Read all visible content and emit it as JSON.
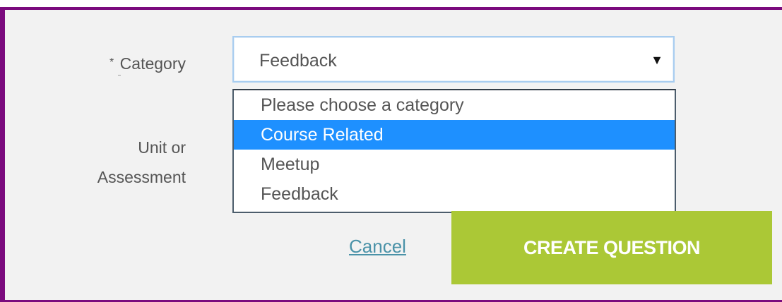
{
  "form": {
    "category_required_mark": "*",
    "category_label": "Category",
    "unit_label_line1": "Unit or",
    "unit_label_line2": "Assessment",
    "category_select": {
      "selected_value": "Feedback",
      "arrow_glyph": "▼",
      "options": [
        {
          "label": "Please choose a category",
          "highlighted": false
        },
        {
          "label": "Course Related",
          "highlighted": true
        },
        {
          "label": "Meetup",
          "highlighted": false
        },
        {
          "label": "Feedback",
          "highlighted": false
        }
      ]
    },
    "cancel_label": "Cancel",
    "create_button_label": "CREATE QUESTION"
  },
  "colors": {
    "frame_border": "#7b0b7e",
    "panel_background": "#f2f2f2",
    "option_highlight": "#1e90ff",
    "primary_button": "#abc836",
    "link": "#4a92a8"
  }
}
